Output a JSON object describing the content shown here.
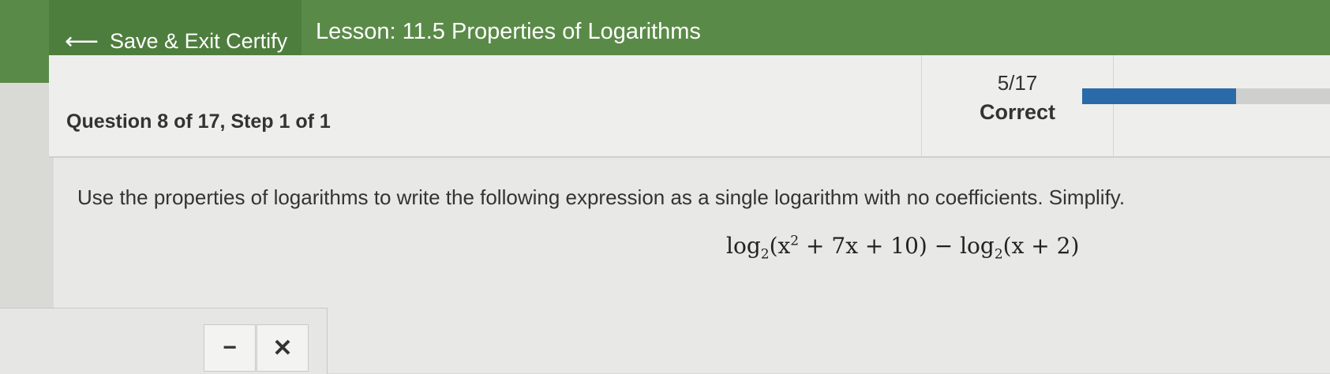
{
  "header": {
    "back_arrow": "⟵",
    "save_exit_label": "Save & Exit Certify",
    "lesson_title": "Lesson: 11.5 Properties of Logarithms"
  },
  "question": {
    "title": "Question 8 of 17, Step 1 of 1",
    "score_fraction": "5/17",
    "score_status": "Correct",
    "progress_fraction": 0.62,
    "instructions": "Use the properties of logarithms to write the following expression as a single logarithm with no coefficients. Simplify.",
    "expression": {
      "log1": "log",
      "base1": "2",
      "arg1_open": "(x",
      "exp": "2",
      "arg1_rest": " + 7x + 10) − ",
      "log2": "log",
      "base2": "2",
      "arg2": "(x + 2)"
    }
  },
  "answer_tools": {
    "minus_label": "−",
    "clear_label": "✕"
  },
  "colors": {
    "header_green": "#5a8a48",
    "progress_blue": "#2b6aa8"
  }
}
